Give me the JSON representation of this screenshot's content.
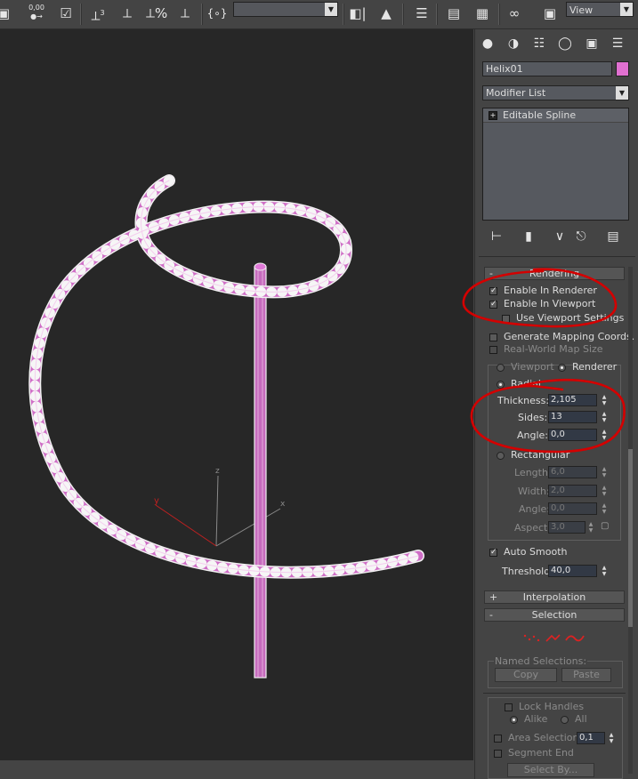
{
  "toolbar": {
    "snap_value": "0,00",
    "snap_superscript": "3",
    "curly_label": "{∘}",
    "view_dropdown": "View"
  },
  "viewport": {
    "axis_z": "z",
    "axis_x": "x",
    "axis_y": "y"
  },
  "panel": {
    "object_name": "Helix01",
    "object_color": "#e070d0",
    "modifier_list": "Modifier List",
    "stack_item": "Editable Spline",
    "rendering": {
      "title": "Rendering",
      "enable_renderer": "Enable In Renderer",
      "enable_viewport": "Enable In Viewport",
      "use_viewport_settings": "Use Viewport Settings",
      "generate_mapping": "Generate Mapping Coords.",
      "real_world": "Real-World Map Size",
      "viewport_radio": "Viewport",
      "renderer_radio": "Renderer",
      "radial": "Radial",
      "thickness_label": "Thickness:",
      "thickness_value": "2,105",
      "sides_label": "Sides:",
      "sides_value": "13",
      "angle_label": "Angle:",
      "angle_value": "0,0",
      "rectangular": "Rectangular",
      "length_label": "Length:",
      "length_value": "6,0",
      "width_label": "Width:",
      "width_value": "2,0",
      "angle2_label": "Angle:",
      "angle2_value": "0,0",
      "aspect_label": "Aspect:",
      "aspect_value": "3,0",
      "auto_smooth": "Auto Smooth",
      "threshold_label": "Threshold:",
      "threshold_value": "40,0"
    },
    "interpolation": {
      "sign": "+",
      "title": "Interpolation"
    },
    "selection": {
      "sign": "-",
      "title": "Selection",
      "named_selections": "Named Selections:",
      "copy": "Copy",
      "paste": "Paste",
      "lock_handles": "Lock Handles",
      "alike": "Alike",
      "all": "All",
      "area_selection": "Area Selection:",
      "area_value": "0,1",
      "segment_end": "Segment End",
      "select_by": "Select By..."
    }
  },
  "colors": {
    "viewport_bg": "#272727",
    "helix": "#e07ad8",
    "annotation": "#d40000"
  }
}
